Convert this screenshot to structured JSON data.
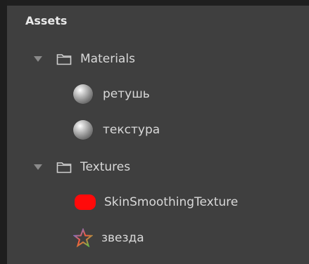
{
  "panel": {
    "title": "Assets"
  },
  "tree": {
    "materials": {
      "label": "Materials",
      "children": [
        {
          "label": "ретушь",
          "icon": "material-sphere-icon"
        },
        {
          "label": "текстура",
          "icon": "material-sphere-icon"
        }
      ]
    },
    "textures": {
      "label": "Textures",
      "children": [
        {
          "label": "SkinSmoothingTexture",
          "icon": "red-texture-icon"
        },
        {
          "label": "звезда",
          "icon": "star-icon"
        }
      ]
    }
  },
  "colors": {
    "background": "#3f3f3f",
    "text": "#d9d9d9",
    "title": "#e9e9e9",
    "border": "#1e1e1e",
    "texture_red": "#ff0a0a"
  }
}
